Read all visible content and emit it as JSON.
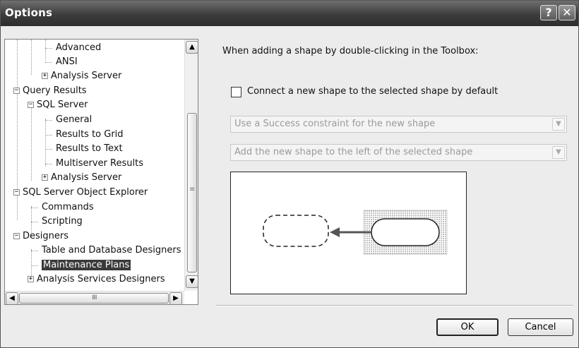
{
  "window": {
    "title": "Options",
    "help_glyph": "?",
    "close_glyph": "✕"
  },
  "tree": {
    "items": [
      {
        "label": "Advanced",
        "expander": ""
      },
      {
        "label": "ANSI",
        "expander": ""
      },
      {
        "label": "Analysis Server",
        "expander": "+"
      },
      {
        "label": "Query Results",
        "expander": "−"
      },
      {
        "label": "SQL Server",
        "expander": "−"
      },
      {
        "label": "General",
        "expander": ""
      },
      {
        "label": "Results to Grid",
        "expander": ""
      },
      {
        "label": "Results to Text",
        "expander": ""
      },
      {
        "label": "Multiserver Results",
        "expander": ""
      },
      {
        "label": "Analysis Server",
        "expander": "+"
      },
      {
        "label": "SQL Server Object Explorer",
        "expander": "−"
      },
      {
        "label": "Commands",
        "expander": ""
      },
      {
        "label": "Scripting",
        "expander": ""
      },
      {
        "label": "Designers",
        "expander": "−"
      },
      {
        "label": "Table and Database Designers",
        "expander": ""
      },
      {
        "label": "Maintenance Plans",
        "expander": "",
        "selected": true
      },
      {
        "label": "Analysis Services Designers",
        "expander": "+"
      }
    ],
    "scroll_up_glyph": "▲",
    "scroll_down_glyph": "▼",
    "scroll_left_glyph": "◀",
    "scroll_right_glyph": "▶",
    "h_grip": "IIII",
    "v_grip": "≡"
  },
  "settings": {
    "prompt": "When adding a shape by double-clicking in the Toolbox:",
    "checkbox_label": "Connect a new shape to the selected shape by default",
    "checkbox_checked": false,
    "constraint_select": "Use a Success constraint for the new shape",
    "position_select": "Add the new shape to the left of the selected shape",
    "combo_arrow": "▼"
  },
  "buttons": {
    "ok": "OK",
    "cancel": "Cancel"
  }
}
